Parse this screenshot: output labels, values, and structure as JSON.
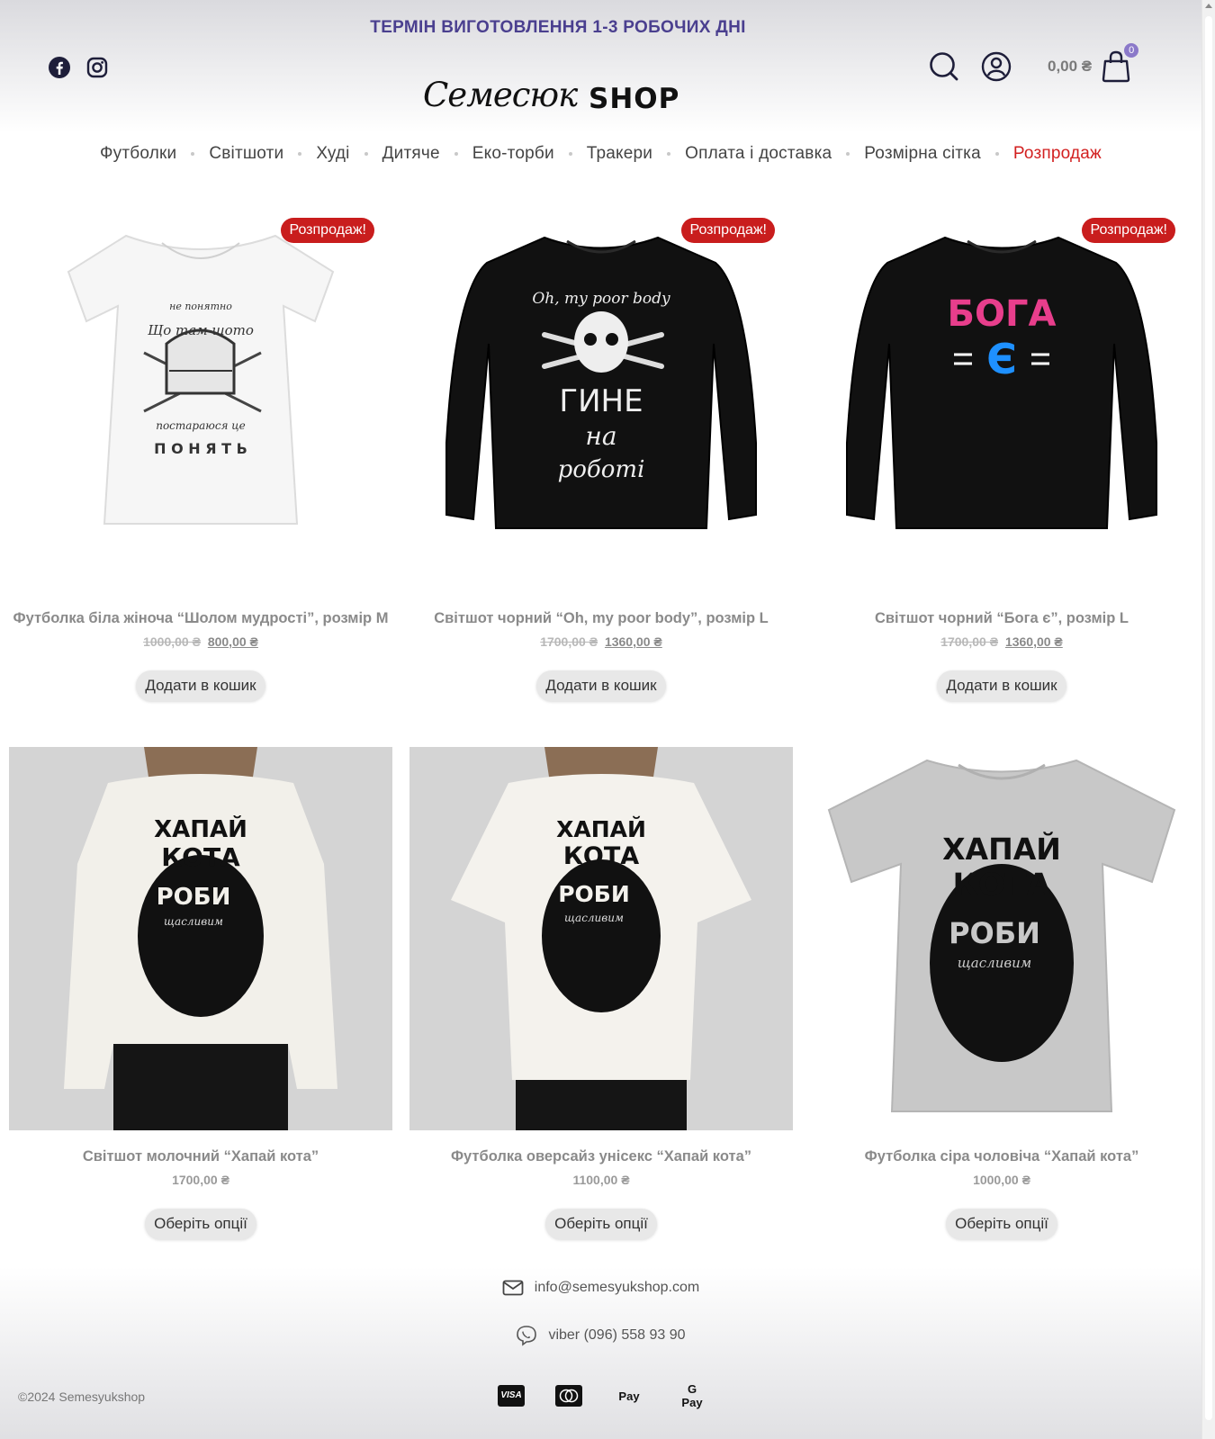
{
  "header": {
    "banner": "ТЕРМІН ВИГОТОВЛЕННЯ 1-3 РОБОЧИХ ДНІ",
    "logo_script": "Cемесюк",
    "logo_shop": "SHOP",
    "cart_total": "0,00 ₴",
    "cart_count": "0"
  },
  "nav": [
    {
      "label": "Футболки"
    },
    {
      "label": "Світшоти"
    },
    {
      "label": "Худі"
    },
    {
      "label": "Дитяче"
    },
    {
      "label": "Еко-торби"
    },
    {
      "label": "Тракери"
    },
    {
      "label": "Оплата і доставка"
    },
    {
      "label": "Розмірна сітка"
    },
    {
      "label": "Розпродаж"
    }
  ],
  "products": [
    {
      "title": "Футболка біла жіноча “Шолом мудрості”, розмір M",
      "badge": "Розпродаж!",
      "old_price": "1000,00 ₴",
      "price": "800,00 ₴",
      "button": "Додати в кошик",
      "print_line1": "Що там шото",
      "print_line2": "не понятно",
      "print_line3": "постараюся це",
      "print_line4": "П О Н Я Т Ь"
    },
    {
      "title": "Світшот чорний “Oh, my poor body”, розмір L",
      "badge": "Розпродаж!",
      "old_price": "1700,00 ₴",
      "price": "1360,00 ₴",
      "button": "Додати в кошик",
      "print_line1": "Oh, my poor body",
      "print_line2": "ГИНЕ",
      "print_line3": "на",
      "print_line4": "роботі"
    },
    {
      "title": "Світшот чорний “Бога є”, розмір L",
      "badge": "Розпродаж!",
      "old_price": "1700,00 ₴",
      "price": "1360,00 ₴",
      "button": "Додати в кошик",
      "print_line1": "БОГА",
      "print_line2": "Є"
    },
    {
      "title": "Світшот молочний “Хапай кота”",
      "price": "1700,00 ₴",
      "button": "Оберіть опції",
      "print_line1": "ХАПАЙ",
      "print_line2": "КОТА",
      "print_line3": "РОБИ",
      "print_line4": "щасливим"
    },
    {
      "title": "Футболка оверсайз унісекс “Хапай кота”",
      "price": "1100,00 ₴",
      "button": "Оберіть опції",
      "print_line1": "ХАПАЙ",
      "print_line2": "КОТА",
      "print_line3": "РОБИ",
      "print_line4": "щасливим"
    },
    {
      "title": "Футболка сіра чоловіча “Хапай кота”",
      "price": "1000,00 ₴",
      "button": "Оберіть опції",
      "print_line1": "ХАПАЙ",
      "print_line2": "КОТА",
      "print_line3": "РОБИ",
      "print_line4": "щасливим"
    }
  ],
  "footer": {
    "email": "info@semesyukshop.com",
    "viber": "viber (096) 558 93 90",
    "copyright": "©2024 Semesyukshop",
    "payments": {
      "visa": "VISA",
      "applepay": " Pay",
      "googlepay": "G Pay"
    }
  },
  "colors": {
    "accent": "#4a3f8f",
    "sale": "#d21f1f",
    "badge": "#c91d1d",
    "cart_badge": "#8b79c9"
  },
  "icons": [
    "facebook-icon",
    "instagram-icon",
    "search-icon",
    "user-icon",
    "cart-icon",
    "mail-icon",
    "viber-icon",
    "visa-icon",
    "mastercard-icon",
    "apple-pay-icon",
    "google-pay-icon"
  ]
}
